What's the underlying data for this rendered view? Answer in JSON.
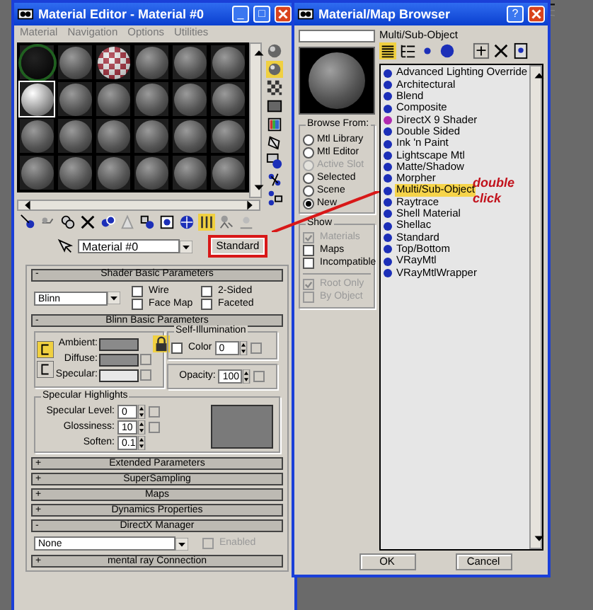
{
  "material_editor": {
    "title": "Material Editor - Material #0",
    "window_buttons": [
      "_",
      "□"
    ],
    "menu": [
      "Material",
      "Navigation",
      "Options",
      "Utilities"
    ],
    "slots": [
      {
        "kind": "black",
        "selected": false
      },
      {
        "kind": "gray",
        "selected": false
      },
      {
        "kind": "checker",
        "selected": false
      },
      {
        "kind": "gray",
        "selected": false
      },
      {
        "kind": "gray",
        "selected": false
      },
      {
        "kind": "gray",
        "selected": false
      },
      {
        "kind": "light",
        "selected": true
      },
      {
        "kind": "gray",
        "selected": false
      },
      {
        "kind": "gray",
        "selected": false
      },
      {
        "kind": "gray",
        "selected": false
      },
      {
        "kind": "gray",
        "selected": false
      },
      {
        "kind": "gray",
        "selected": false
      },
      {
        "kind": "gray",
        "selected": false
      },
      {
        "kind": "gray",
        "selected": false
      },
      {
        "kind": "gray",
        "selected": false
      },
      {
        "kind": "gray",
        "selected": false
      },
      {
        "kind": "gray",
        "selected": false
      },
      {
        "kind": "gray",
        "selected": false
      },
      {
        "kind": "gray",
        "selected": false
      },
      {
        "kind": "gray",
        "selected": false
      },
      {
        "kind": "gray",
        "selected": false
      },
      {
        "kind": "gray",
        "selected": false
      },
      {
        "kind": "gray",
        "selected": false
      },
      {
        "kind": "gray",
        "selected": false
      }
    ],
    "material_name": "Material #0",
    "type_button": {
      "label": "Standard",
      "highlighted": true
    },
    "rollouts": [
      {
        "title": "Shader Basic Parameters",
        "toggle": "-",
        "kind": "shader",
        "shader": "Blinn",
        "options": [
          {
            "label": "Wire",
            "checked": false
          },
          {
            "label": "2-Sided",
            "checked": false
          },
          {
            "label": "Face Map",
            "checked": false
          },
          {
            "label": "Faceted",
            "checked": false
          }
        ]
      },
      {
        "title": "Blinn Basic Parameters",
        "toggle": "-",
        "kind": "blinn",
        "colors": [
          {
            "label": "Ambient:",
            "color": "#8a8a8a"
          },
          {
            "label": "Diffuse:",
            "color": "#8a8a8a"
          },
          {
            "label": "Specular:",
            "color": "#e8e8e8"
          }
        ],
        "locked": true,
        "self_illumination": {
          "title": "Self-Illumination",
          "checkbox": {
            "label": "Color",
            "checked": false
          },
          "value": "0"
        },
        "opacity": {
          "label": "Opacity:",
          "value": "100"
        },
        "specular_highlights": {
          "title": "Specular Highlights",
          "fields": [
            {
              "label": "Specular Level:",
              "value": "0"
            },
            {
              "label": "Glossiness:",
              "value": "10"
            },
            {
              "label": "Soften:",
              "value": "0.1"
            }
          ]
        }
      },
      {
        "title": "Extended Parameters",
        "toggle": "+"
      },
      {
        "title": "SuperSampling",
        "toggle": "+"
      },
      {
        "title": "Maps",
        "toggle": "+"
      },
      {
        "title": "Dynamics Properties",
        "toggle": "+"
      },
      {
        "title": "DirectX Manager",
        "toggle": "-",
        "kind": "directx",
        "dropdown": "None",
        "checkbox": {
          "label": "Enabled",
          "checked": false,
          "disabled": true
        }
      },
      {
        "title": "mental ray Connection",
        "toggle": "+"
      }
    ]
  },
  "browser": {
    "title": "Material/Map Browser",
    "help": "?",
    "list_title": "Multi/Sub-Object",
    "browse_from": {
      "title": "Browse From:",
      "options": [
        {
          "label": "Mtl Library",
          "selected": false,
          "disabled": false
        },
        {
          "label": "Mtl Editor",
          "selected": false,
          "disabled": false
        },
        {
          "label": "Active Slot",
          "selected": false,
          "disabled": true
        },
        {
          "label": "Selected",
          "selected": false,
          "disabled": false
        },
        {
          "label": "Scene",
          "selected": false,
          "disabled": false
        },
        {
          "label": "New",
          "selected": true,
          "disabled": false
        }
      ]
    },
    "show": {
      "title": "Show",
      "options": [
        {
          "label": "Materials",
          "checked": true,
          "disabled": true
        },
        {
          "label": "Maps",
          "checked": false,
          "disabled": false
        },
        {
          "label": "Incompatible",
          "checked": false,
          "disabled": false
        }
      ],
      "options_2": [
        {
          "label": "Root Only",
          "checked": true,
          "disabled": true
        },
        {
          "label": "By Object",
          "checked": false,
          "disabled": true
        }
      ]
    },
    "items": [
      {
        "label": "Advanced Lighting Override",
        "color": "#1c2fb8",
        "selected": false
      },
      {
        "label": "Architectural",
        "color": "#1c2fb8",
        "selected": false
      },
      {
        "label": "Blend",
        "color": "#1c2fb8",
        "selected": false
      },
      {
        "label": "Composite",
        "color": "#1c2fb8",
        "selected": false
      },
      {
        "label": "DirectX 9 Shader",
        "color": "#b02ab0",
        "selected": false
      },
      {
        "label": "Double Sided",
        "color": "#1c2fb8",
        "selected": false
      },
      {
        "label": "Ink 'n Paint",
        "color": "#1c2fb8",
        "selected": false
      },
      {
        "label": "Lightscape Mtl",
        "color": "#1c2fb8",
        "selected": false
      },
      {
        "label": "Matte/Shadow",
        "color": "#1c2fb8",
        "selected": false
      },
      {
        "label": "Morpher",
        "color": "#1c2fb8",
        "selected": false
      },
      {
        "label": "Multi/Sub-Object",
        "color": "#1c2fb8",
        "selected": true
      },
      {
        "label": "Raytrace",
        "color": "#1c2fb8",
        "selected": false
      },
      {
        "label": "Shell Material",
        "color": "#1c2fb8",
        "selected": false
      },
      {
        "label": "Shellac",
        "color": "#1c2fb8",
        "selected": false
      },
      {
        "label": "Standard",
        "color": "#1c2fb8",
        "selected": false
      },
      {
        "label": "Top/Bottom",
        "color": "#1c2fb8",
        "selected": false
      },
      {
        "label": "VRayMtl",
        "color": "#1c2fb8",
        "selected": false
      },
      {
        "label": "VRayMtlWrapper",
        "color": "#1c2fb8",
        "selected": false
      }
    ],
    "buttons": [
      "OK",
      "Cancel"
    ]
  },
  "annotation": {
    "text": "double click"
  }
}
